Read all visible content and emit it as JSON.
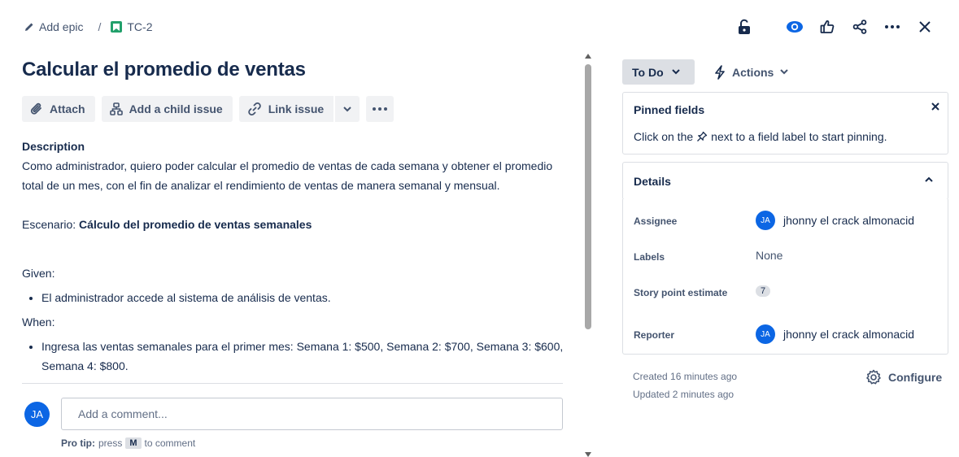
{
  "breadcrumb": {
    "epic_label": "Add epic",
    "separator": "/",
    "issue_key": "TC-2"
  },
  "issue": {
    "title": "Calcular el promedio de ventas"
  },
  "toolbar": {
    "attach": "Attach",
    "add_child": "Add a child issue",
    "link_issue": "Link issue"
  },
  "description": {
    "label": "Description",
    "intro": "Como administrador, quiero poder calcular el promedio de ventas de cada semana y obtener el promedio total de un mes, con el fin de analizar el rendimiento de ventas de manera semanal y mensual.",
    "scenario_prefix": "Escenario: ",
    "scenario_title": "Cálculo del promedio de ventas semanales",
    "given_label": "Given:",
    "given_items": [
      "El administrador accede al sistema de análisis de ventas."
    ],
    "when_label": "When:",
    "when_items": [
      "Ingresa las ventas semanales para el primer mes: Semana 1: $500, Semana 2: $700, Semana 3: $600, Semana 4: $800."
    ]
  },
  "comment": {
    "avatar_initials": "JA",
    "placeholder": "Add a comment...",
    "pro_tip_label": "Pro tip:",
    "pro_tip_press": "press",
    "pro_tip_key": "M",
    "pro_tip_suffix": "to comment"
  },
  "status": {
    "current": "To Do",
    "actions_label": "Actions"
  },
  "pinned": {
    "title": "Pinned fields",
    "text_before": "Click on the",
    "text_after": "next to a field label to start pinning."
  },
  "details": {
    "title": "Details",
    "assignee_label": "Assignee",
    "assignee_initials": "JA",
    "assignee_name": "jhonny el crack almonacid",
    "labels_label": "Labels",
    "labels_value": "None",
    "story_points_label": "Story point estimate",
    "story_points_value": "7",
    "reporter_label": "Reporter",
    "reporter_initials": "JA",
    "reporter_name": "jhonny el crack almonacid"
  },
  "meta": {
    "created": "Created 16 minutes ago",
    "updated": "Updated 2 minutes ago",
    "configure": "Configure"
  },
  "icons": {
    "edit": "pencil-icon",
    "story": "bookmark-icon",
    "lock": "unlock-icon",
    "watch": "eye-icon",
    "vote": "thumbs-up-icon",
    "share": "share-icon",
    "more": "more-icon",
    "close": "close-icon"
  },
  "colors": {
    "accent": "#0c66e4",
    "story_green": "#22a06b",
    "text": "#172b4d",
    "subtle": "#44546f"
  }
}
